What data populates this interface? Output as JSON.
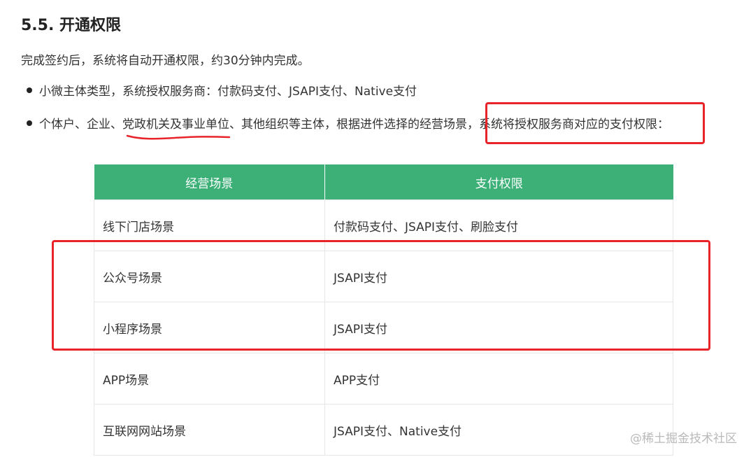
{
  "heading": "5.5. 开通权限",
  "intro": "完成签约后，系统将自动开通权限，约30分钟内完成。",
  "bullets": [
    {
      "text": "小微主体类型，系统授权服务商：付款码支付、JSAPI支付、Native支付"
    },
    {
      "text": "个体户、企业、党政机关及事业单位、其他组织等主体，根据进件选择的经营场景，系统将授权服务商对应的支付权限："
    }
  ],
  "table": {
    "headers": [
      "经营场景",
      "支付权限"
    ],
    "rows": [
      [
        "线下门店场景",
        "付款码支付、JSAPI支付、刷脸支付"
      ],
      [
        "公众号场景",
        "JSAPI支付"
      ],
      [
        "小程序场景",
        "JSAPI支付"
      ],
      [
        "APP场景",
        "APP支付"
      ],
      [
        "互联网网站场景",
        "JSAPI支付、Native支付"
      ]
    ]
  },
  "annotations": {
    "color": "#e8242a"
  },
  "colors": {
    "table_header": "#3db078"
  },
  "watermark": "@稀土掘金技术社区"
}
